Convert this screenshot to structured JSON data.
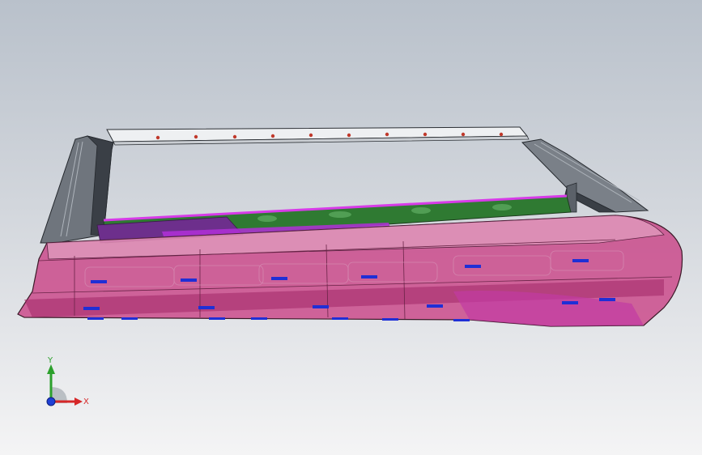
{
  "viewport": {
    "background_top": "#b9c1cb",
    "background_bottom": "#f4f4f5"
  },
  "model": {
    "description_icon": "cad-assembly-icon",
    "colors": {
      "body_magenta": "#c8377f",
      "body_pink": "#e3a3c2",
      "frame_dark": "#3a3f46",
      "frame_gray": "#8d939b",
      "rail_white": "#eef0f2",
      "rail_dots": "#c0392b",
      "inner_green": "#2f7a32",
      "inner_purple": "#b12fd8",
      "clip_blue": "#1f2fd6"
    }
  },
  "triad": {
    "x_label": "X",
    "y_label": "Y",
    "x_color": "#d62728",
    "y_color": "#2ca02c",
    "z_color": "#1f3fd6"
  }
}
